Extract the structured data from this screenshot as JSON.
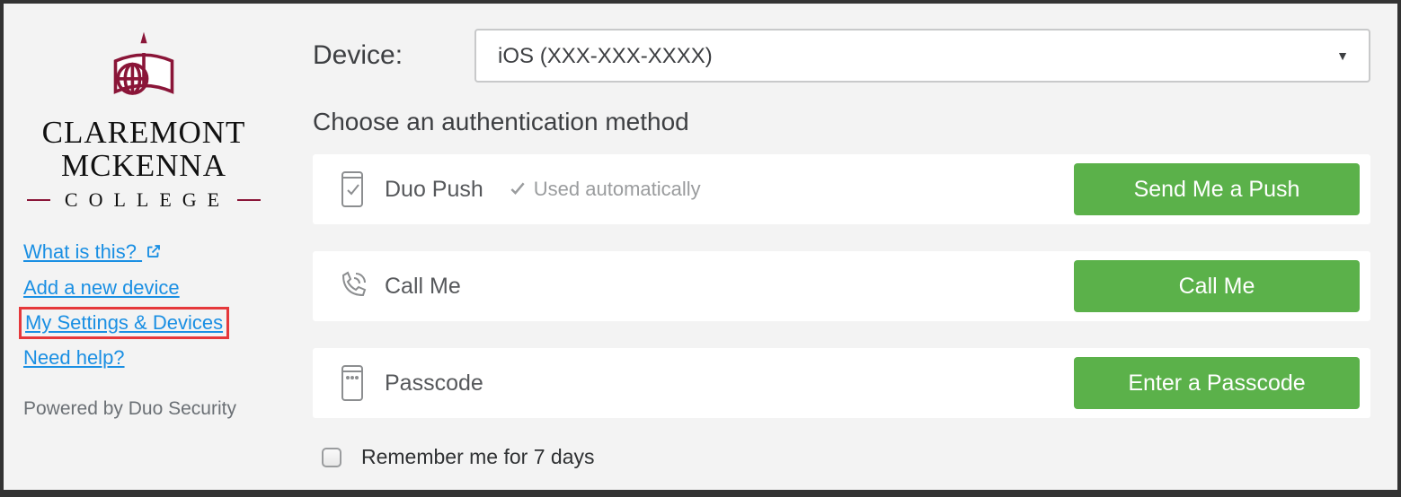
{
  "logo": {
    "line1": "CLAREMONT",
    "line2": "MCKENNA",
    "college": "COLLEGE"
  },
  "sidebar": {
    "links": {
      "what_is_this": "What is this?",
      "add_device": "Add a new device",
      "my_settings": "My Settings & Devices",
      "need_help": "Need help?"
    },
    "powered": "Powered by Duo Security"
  },
  "device": {
    "label": "Device:",
    "selected": "iOS (XXX-XXX-XXXX)"
  },
  "heading": "Choose an authentication method",
  "methods": {
    "push": {
      "label": "Duo Push",
      "sub": "Used automatically",
      "button": "Send Me a Push"
    },
    "call": {
      "label": "Call Me",
      "button": "Call Me"
    },
    "passcode": {
      "label": "Passcode",
      "button": "Enter a Passcode"
    }
  },
  "remember": {
    "label": "Remember me for 7 days"
  }
}
